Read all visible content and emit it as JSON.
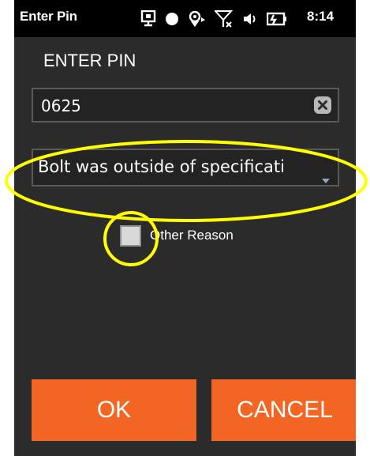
{
  "status_bar": {
    "title": "Enter Pin",
    "time": "8:14",
    "icons": [
      "sync-icon",
      "record-dot-icon",
      "gps-icon",
      "signal-off-icon",
      "volume-icon",
      "battery-icon"
    ]
  },
  "dialog": {
    "heading": "ENTER PIN",
    "pin_value": "0625",
    "clear_icon": "clear-x-icon",
    "reason_selected": "Bolt was outside of specificati",
    "other_reason_label": "Other Reason",
    "other_reason_checked": false
  },
  "buttons": {
    "ok_label": "OK",
    "cancel_label": "CANCEL"
  },
  "colors": {
    "background": "#2b2b2b",
    "accent_button": "#f26522",
    "annotation_highlight": "#ffff00"
  }
}
